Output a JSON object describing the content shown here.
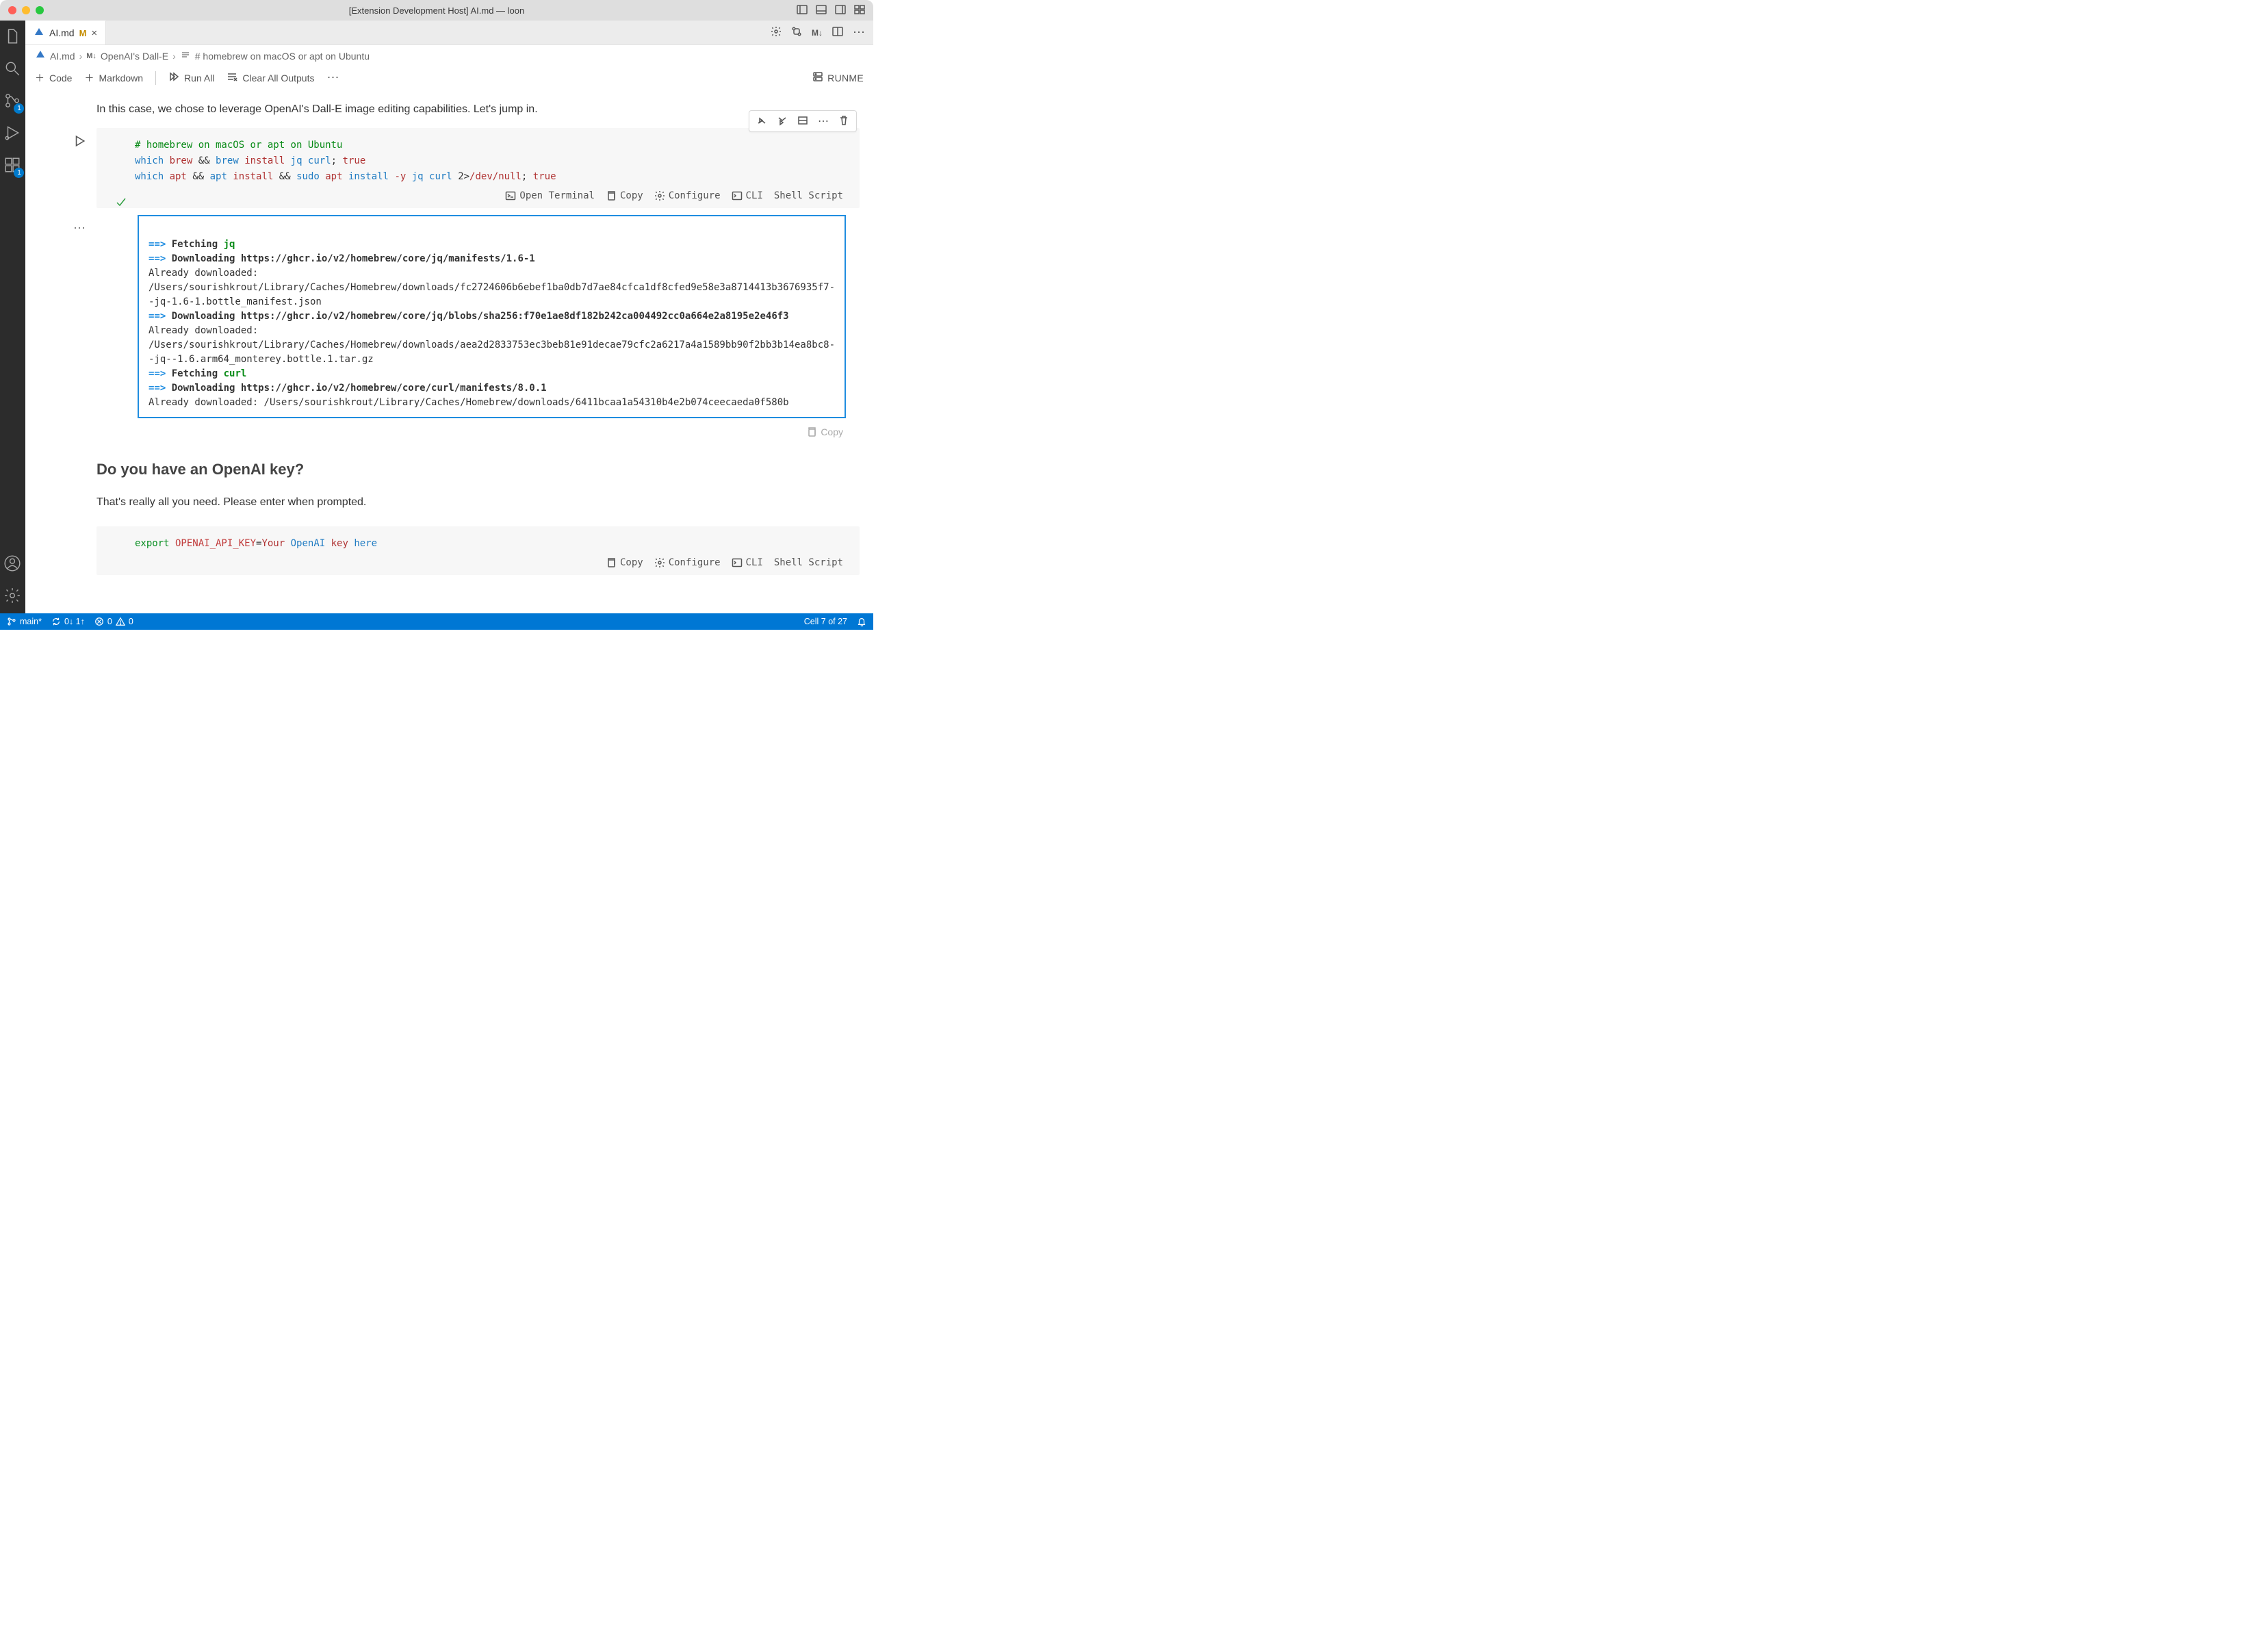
{
  "titlebar": {
    "title": "[Extension Development Host] AI.md — loon"
  },
  "tab": {
    "filename": "AI.md",
    "modified_indicator": "M"
  },
  "tabs_actions": {
    "markdown_badge": "M↓"
  },
  "breadcrumbs": {
    "file": "AI.md",
    "section_prefix": "M↓",
    "section": "OpenAI's Dall-E",
    "heading": "# homebrew on macOS or apt on Ubuntu"
  },
  "notebook_toolbar": {
    "code": "Code",
    "markdown": "Markdown",
    "run_all": "Run All",
    "clear_outputs": "Clear All Outputs",
    "runme": "RUNME"
  },
  "prose": {
    "intro": "In this case, we chose to leverage OpenAI's Dall-E image editing capabilities. Let's jump in.",
    "heading2": "Do you have an OpenAI key?",
    "followup": "That's really all you need. Please enter when prompted."
  },
  "code_cell_1": {
    "comment": "# homebrew on macOS or apt on Ubuntu",
    "line2": {
      "which": "which",
      "brew1": "brew",
      "amp1": "&&",
      "brew2": "brew",
      "install": "install",
      "args": "jq curl",
      "semi": ";",
      "true": "true"
    },
    "line3": {
      "which": "which",
      "apt1": "apt",
      "amp1": "&&",
      "apt2": "apt",
      "install1": "install",
      "amp2": "&&",
      "sudo": "sudo",
      "apt3": "apt",
      "install2": "install",
      "flag": "-y",
      "args": "jq curl",
      "redir": "2>",
      "devnull": "/dev/null",
      "semi": ";",
      "true": "true"
    },
    "footer": {
      "open_terminal": "Open Terminal",
      "copy": "Copy",
      "configure": "Configure",
      "cli": "CLI",
      "lang": "Shell Script"
    }
  },
  "output": {
    "l1_prefix": "==>",
    "l1_label": "Fetching",
    "l1_pkg": "jq",
    "l2_prefix": "==>",
    "l2_label": "Downloading",
    "l2_url": "https://ghcr.io/v2/homebrew/core/jq/manifests/1.6-1",
    "l3": "Already downloaded: /Users/sourishkrout/Library/Caches/Homebrew/downloads/fc2724606b6ebef1ba0db7d7ae84cfca1df8cfed9e58e3a8714413b3676935f7--jq-1.6-1.bottle_manifest.json",
    "l4_prefix": "==>",
    "l4_label": "Downloading",
    "l4_url": "https://ghcr.io/v2/homebrew/core/jq/blobs/sha256:f70e1ae8df182b242ca004492cc0a664e2a8195e2e46f3",
    "l5": "Already downloaded: /Users/sourishkrout/Library/Caches/Homebrew/downloads/aea2d2833753ec3beb81e91decae79cfc2a6217a4a1589bb90f2bb3b14ea8bc8--jq--1.6.arm64_monterey.bottle.1.tar.gz",
    "l6_prefix": "==>",
    "l6_label": "Fetching",
    "l6_pkg": "curl",
    "l7_prefix": "==>",
    "l7_label": "Downloading",
    "l7_url": "https://ghcr.io/v2/homebrew/core/curl/manifests/8.0.1",
    "l8": "Already downloaded: /Users/sourishkrout/Library/Caches/Homebrew/downloads/6411bcaa1a54310b4e2b074ceecaeda0f580b",
    "copy": "Copy"
  },
  "code_cell_2": {
    "line": {
      "export": "export",
      "ident": "OPENAI_API_KEY",
      "eq": "=",
      "p1": "Your",
      "p2": "OpenAI",
      "p3": "key",
      "p4": "here"
    },
    "footer": {
      "copy": "Copy",
      "configure": "Configure",
      "cli": "CLI",
      "lang": "Shell Script"
    }
  },
  "activity_badges": {
    "scm": "1",
    "extensions": "1"
  },
  "status": {
    "branch": "main*",
    "sync": "0↓ 1↑",
    "errors": "0",
    "warnings": "0",
    "cell": "Cell 7 of 27"
  }
}
